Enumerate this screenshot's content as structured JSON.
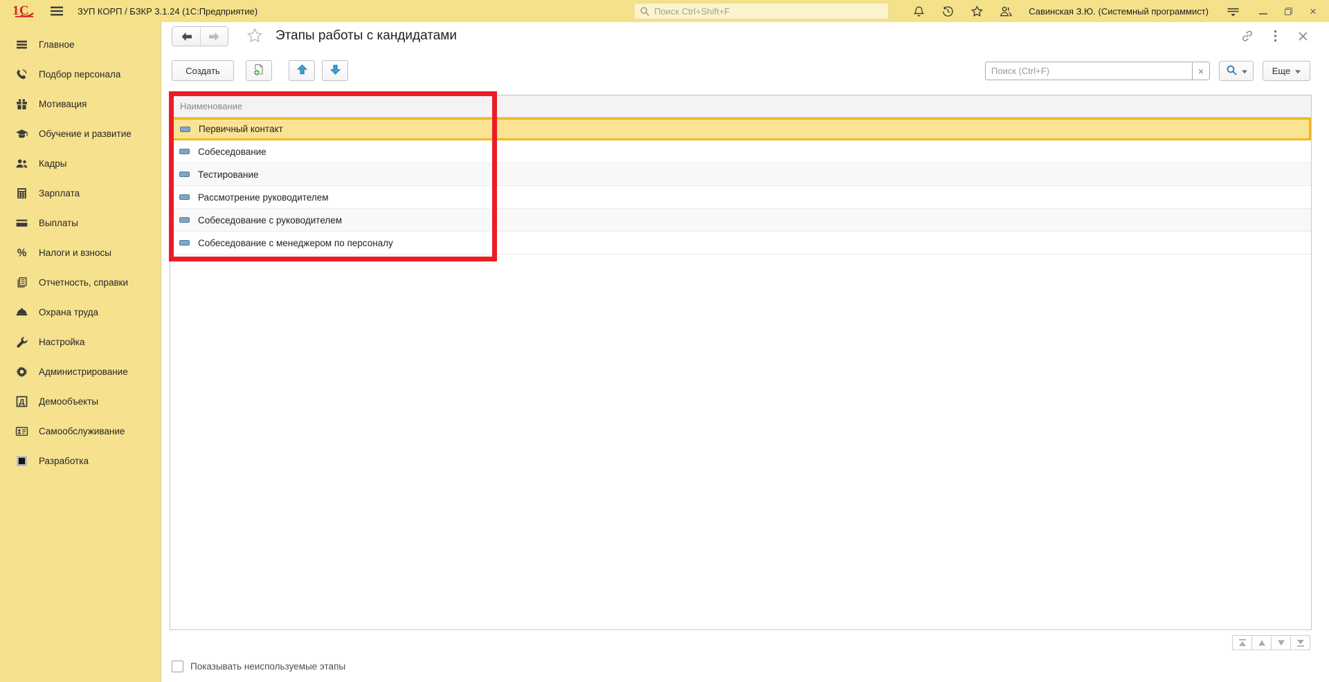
{
  "topbar": {
    "logo_text": "1С",
    "app_title": "ЗУП КОРП / БЗКР 3.1.24  (1С:Предприятие)",
    "search_placeholder": "Поиск Ctrl+Shift+F",
    "user_name": "Савинская З.Ю. (Системный программист)",
    "icons": [
      "bell-icon",
      "history-icon",
      "star-icon",
      "users-icon",
      "service-menu-icon",
      "minimize-icon",
      "restore-icon",
      "close-icon"
    ]
  },
  "sidebar": {
    "items": [
      {
        "id": "glavnoe",
        "label": "Главное",
        "icon": "menu-lines-icon"
      },
      {
        "id": "podbor-personala",
        "label": "Подбор персонала",
        "icon": "phone-icon"
      },
      {
        "id": "motivaciya",
        "label": "Мотивация",
        "icon": "gift-icon"
      },
      {
        "id": "obuchenie-i-razvitie",
        "label": "Обучение и развитие",
        "icon": "grad-cap-icon"
      },
      {
        "id": "kadry",
        "label": "Кадры",
        "icon": "people-icon"
      },
      {
        "id": "zarplata",
        "label": "Зарплата",
        "icon": "calculator-icon"
      },
      {
        "id": "vyplaty",
        "label": "Выплаты",
        "icon": "card-icon"
      },
      {
        "id": "nalogi-i-vznosy",
        "label": "Налоги и взносы",
        "icon": "percent-icon"
      },
      {
        "id": "otchetnost-spravki",
        "label": "Отчетность, справки",
        "icon": "documents-icon"
      },
      {
        "id": "ohrana-truda",
        "label": "Охрана труда",
        "icon": "helmet-icon"
      },
      {
        "id": "nastroyka",
        "label": "Настройка",
        "icon": "wrench-icon"
      },
      {
        "id": "administrirovanie",
        "label": "Администрирование",
        "icon": "gear-icon"
      },
      {
        "id": "demoobekty",
        "label": "Демообъекты",
        "icon": "demo-icon"
      },
      {
        "id": "samoobsluzhivanie",
        "label": "Самообслуживание",
        "icon": "badge-icon"
      },
      {
        "id": "razrabotka",
        "label": "Разработка",
        "icon": "dev-square-icon"
      }
    ]
  },
  "page": {
    "title": "Этапы работы с кандидатами",
    "toolbar": {
      "create_label": "Создать",
      "more_label": "Еще",
      "search_placeholder": "Поиск (Ctrl+F)"
    },
    "table": {
      "header": "Наименование",
      "rows": [
        {
          "label": "Первичный контакт",
          "selected": true
        },
        {
          "label": "Собеседование",
          "selected": false
        },
        {
          "label": "Тестирование",
          "selected": false
        },
        {
          "label": "Рассмотрение руководителем",
          "selected": false
        },
        {
          "label": "Собеседование с руководителем",
          "selected": false
        },
        {
          "label": "Собеседование с менеджером по персоналу",
          "selected": false
        }
      ]
    },
    "footer": {
      "show_unused_label": "Показывать неиспользуемые этапы",
      "show_unused_checked": false
    }
  },
  "colors": {
    "topbar_bg": "#F5E189",
    "sidebar_bg": "#F6E28E",
    "topbar_search_bg": "#FBF4CD",
    "selection_fill": "#FBE394",
    "selection_border": "#F1B71C",
    "annotation_red": "#EA1C25",
    "accent_blue": "#2E7CB8",
    "row_marker": "#7FA6C6",
    "logo_red": "#D8232A"
  }
}
